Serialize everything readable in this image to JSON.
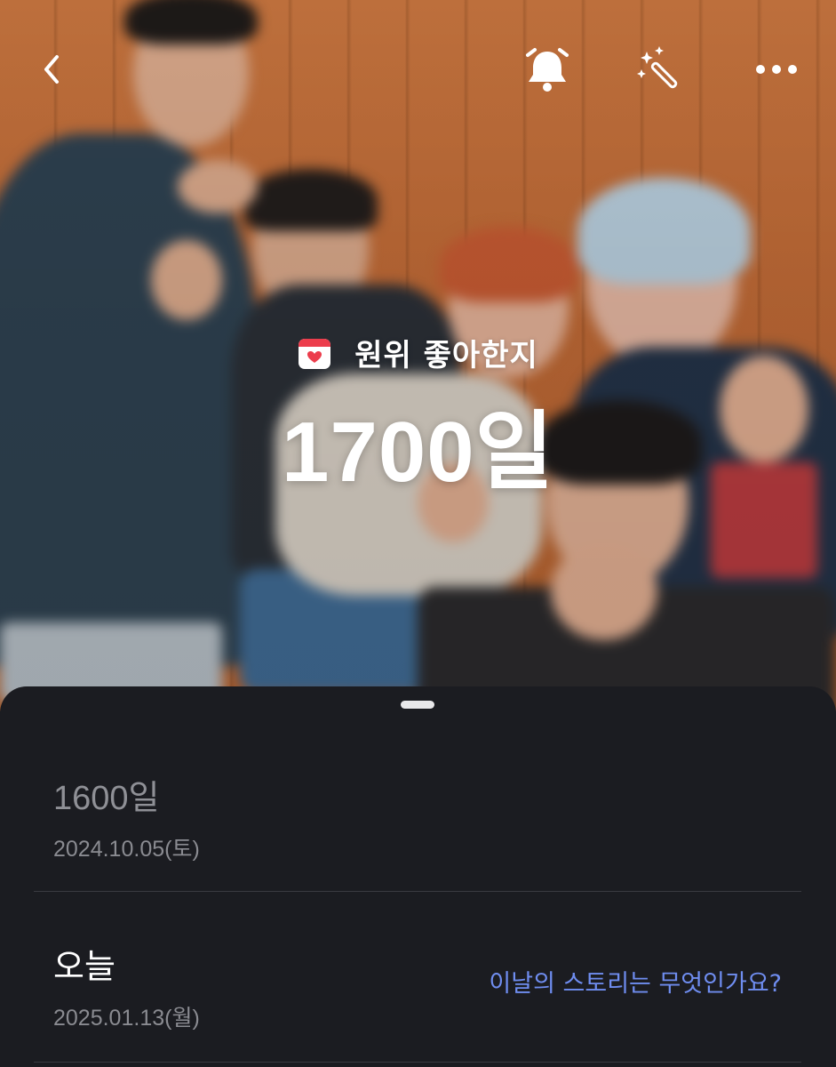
{
  "topbar": {
    "back_icon": "chevron-left-icon",
    "alarm_icon": "bell-icon",
    "effects_icon": "magic-wand-icon",
    "more_icon": "more-horizontal-icon"
  },
  "hero": {
    "calendar_icon": "calendar-heart-icon",
    "label": "원위 좋아한지",
    "count": "1700일"
  },
  "sheet": {
    "items": [
      {
        "title": "1600일",
        "date": "2024.10.05(토)"
      },
      {
        "title": "오늘",
        "date": "2025.01.13(월)",
        "link": "이날의 스토리는 무엇인가요?"
      }
    ]
  },
  "colors": {
    "sheet_bg": "#1b1c21",
    "link": "#6f8df0",
    "calendar_red": "#ec3d4c"
  }
}
